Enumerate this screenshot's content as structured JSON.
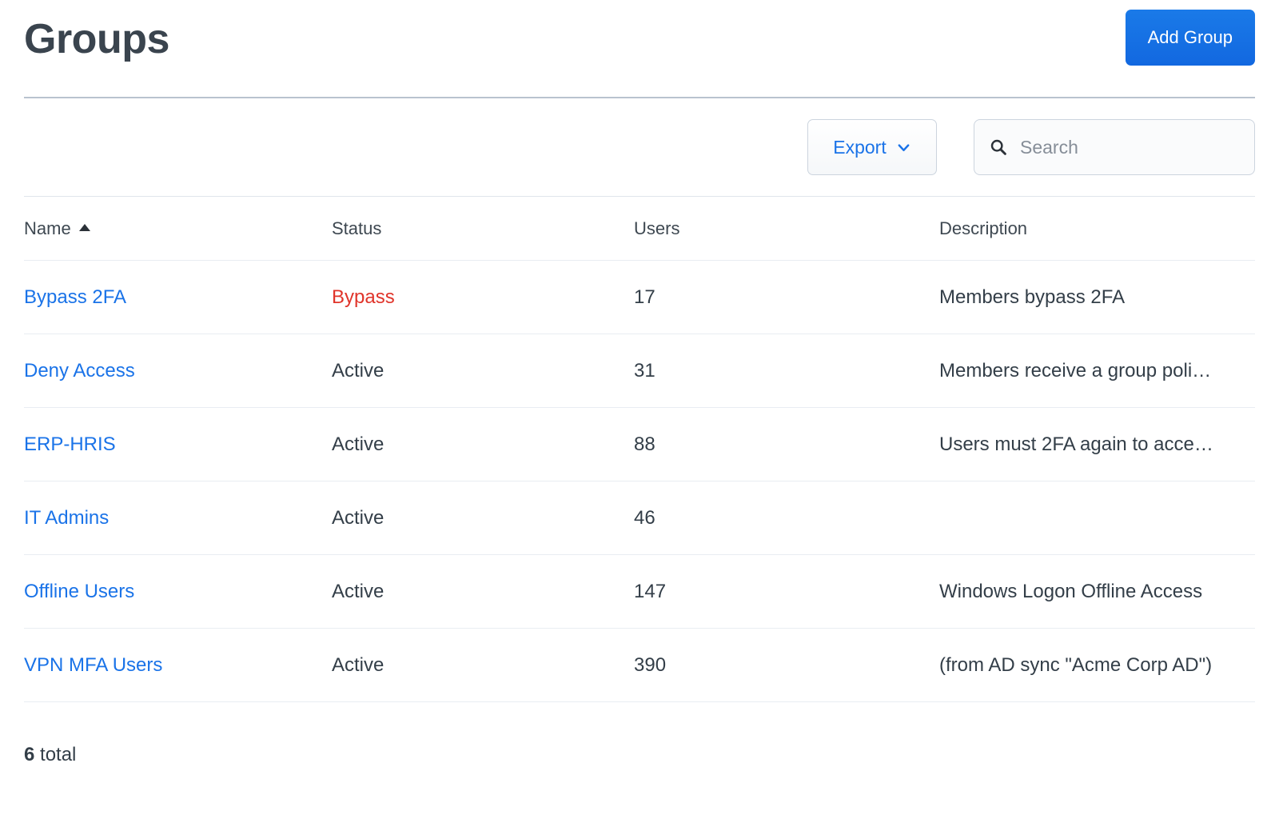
{
  "header": {
    "title": "Groups",
    "add_group_label": "Add Group"
  },
  "toolbar": {
    "export_label": "Export",
    "export_chevron_icon": "chevron-down-icon",
    "search_icon": "search-icon",
    "search_value": "",
    "search_placeholder": "Search"
  },
  "table": {
    "columns": [
      {
        "key": "name",
        "label": "Name",
        "sorted": true,
        "sort_direction": "asc",
        "sort_icon": "caret-up-icon"
      },
      {
        "key": "status",
        "label": "Status",
        "sorted": false
      },
      {
        "key": "users",
        "label": "Users",
        "sorted": false
      },
      {
        "key": "description",
        "label": "Description",
        "sorted": false
      }
    ],
    "rows": [
      {
        "name": "Bypass 2FA",
        "status": "Bypass",
        "status_kind": "bypass",
        "users": "17",
        "description": "Members bypass 2FA"
      },
      {
        "name": "Deny Access",
        "status": "Active",
        "status_kind": "active",
        "users": "31",
        "description": "Members receive a group poli…"
      },
      {
        "name": "ERP-HRIS",
        "status": "Active",
        "status_kind": "active",
        "users": "88",
        "description": "Users must 2FA again to acce…"
      },
      {
        "name": "IT Admins",
        "status": "Active",
        "status_kind": "active",
        "users": "46",
        "description": ""
      },
      {
        "name": "Offline Users",
        "status": "Active",
        "status_kind": "active",
        "users": "147",
        "description": "Windows Logon Offline Access"
      },
      {
        "name": "VPN MFA Users",
        "status": "Active",
        "status_kind": "active",
        "users": "390",
        "description": "(from AD sync \"Acme Corp AD\")"
      }
    ]
  },
  "footer": {
    "total_count": "6",
    "total_label": " total"
  },
  "colors": {
    "accent_blue": "#1a73e8",
    "link_blue": "#1a73e8",
    "status_bypass_red": "#e0342a",
    "text_dark": "#333e48",
    "title_dark": "#3a444e",
    "header_divider": "#b9c3cf",
    "row_divider": "#e9edf2",
    "control_border": "#ccd4de",
    "placeholder_gray": "#868e98"
  }
}
